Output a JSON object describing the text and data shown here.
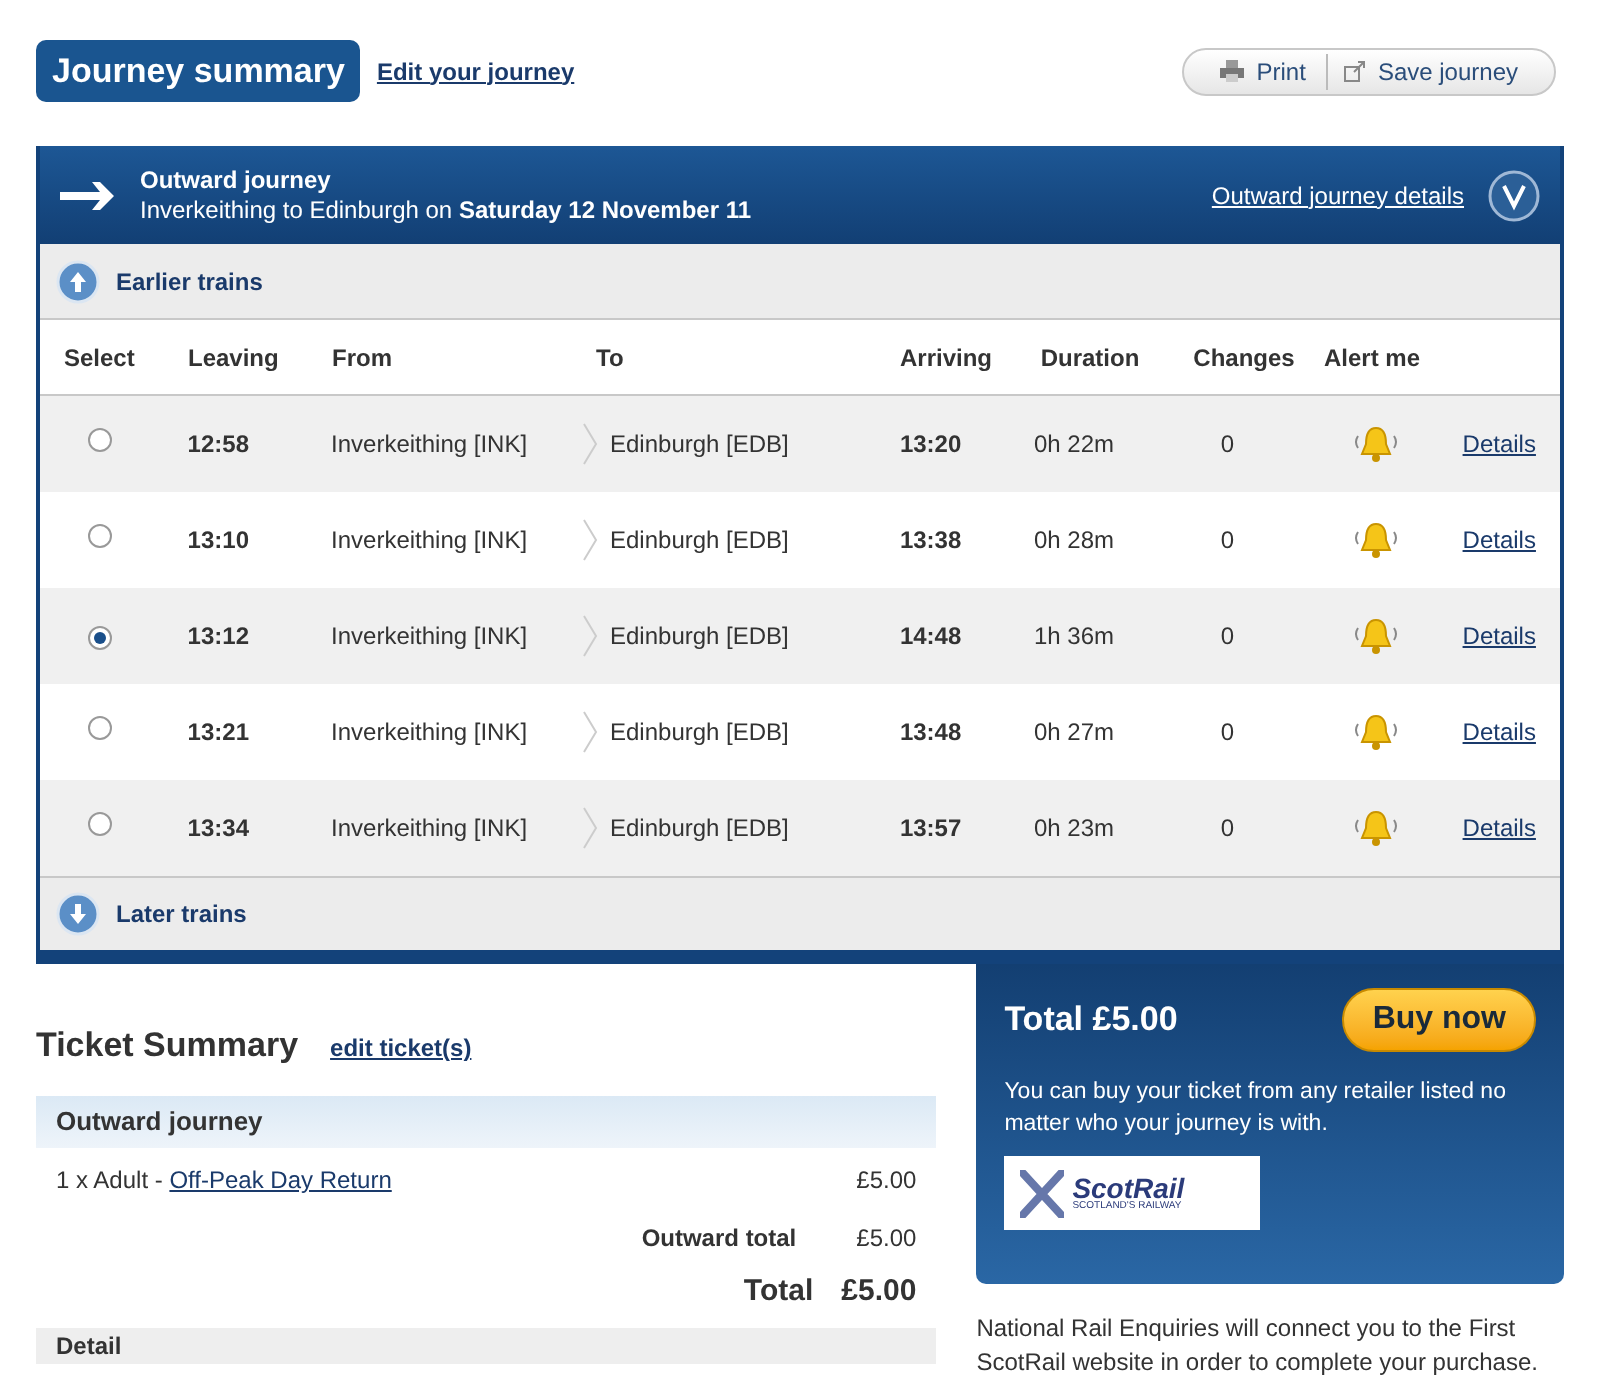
{
  "header": {
    "title": "Journey summary",
    "edit_link": "Edit your journey",
    "actions": [
      "Print",
      "Save journey"
    ]
  },
  "outward": {
    "title": "Outward journey",
    "route": "Inverkeithing to Edinburgh on **Saturday 12 November 11**",
    "details_link": "Outward journey details",
    "earlier": "Earlier trains",
    "later": "Later trains",
    "columns": [
      "Select",
      "Leaving",
      "From",
      "To",
      "Arriving",
      "Duration",
      "Changes",
      "Alert me"
    ],
    "rows": [
      {
        "selected": false,
        "leaving": "12:58",
        "from": "Inverkeithing [INK]",
        "to": "Edinburgh [EDB]",
        "arriving": "13:20",
        "duration": "0h 22m",
        "changes": "0",
        "link": "Details"
      },
      {
        "selected": false,
        "leaving": "13:10",
        "from": "Inverkeithing [INK]",
        "to": "Edinburgh [EDB]",
        "arriving": "13:38",
        "duration": "0h 28m",
        "changes": "0",
        "link": "Details"
      },
      {
        "selected": true,
        "leaving": "13:12",
        "from": "Inverkeithing [INK]",
        "to": "Edinburgh [EDB]",
        "arriving": "14:48",
        "duration": "1h 36m",
        "changes": "0",
        "link": "Details"
      },
      {
        "selected": false,
        "leaving": "13:21",
        "from": "Inverkeithing [INK]",
        "to": "Edinburgh [EDB]",
        "arriving": "13:48",
        "duration": "0h 27m",
        "changes": "0",
        "link": "Details"
      },
      {
        "selected": false,
        "leaving": "13:34",
        "from": "Inverkeithing [INK]",
        "to": "Edinburgh [EDB]",
        "arriving": "13:57",
        "duration": "0h 23m",
        "changes": "0",
        "link": "Details"
      }
    ]
  },
  "ticket_summary": {
    "title": "Ticket Summary",
    "edit_link": "edit ticket(s)",
    "section": "Outward journey",
    "item_prefix": "1 x Adult - ",
    "item_link": "Off-Peak Day Return",
    "item_price": "£5.00",
    "outward_total_label": "Outward total",
    "outward_total": "£5.00",
    "total_label": "Total",
    "total": "£5.00",
    "next_section": "Detail"
  },
  "buy_box": {
    "total": "Total £5.00",
    "button": "Buy now",
    "note": "You can buy your ticket from any retailer listed no matter who your journey is with.",
    "logo_text": "ScotRail",
    "logo_sub": "SCOTLAND'S RAILWAY"
  },
  "footer_note": "National Rail Enquiries will connect you to the First ScotRail website in order to complete your purchase."
}
